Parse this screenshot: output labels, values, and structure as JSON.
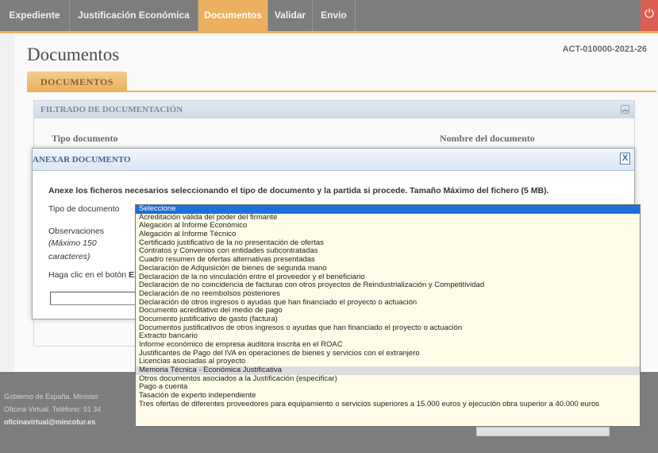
{
  "nav": {
    "items": [
      {
        "label": "Expediente"
      },
      {
        "label": "Justificación Económica"
      },
      {
        "label": "Documentos"
      },
      {
        "label": "Validar"
      },
      {
        "label": "Envio"
      }
    ],
    "active": "Documentos",
    "power_icon": "power-icon",
    "colors": {
      "bar": "#6b6b6b",
      "active": "#e8a54a",
      "power": "#d8483a"
    }
  },
  "page": {
    "title": "Documentos",
    "case_code": "ACT-010000-2021-26",
    "tab": "DOCUMENTOS"
  },
  "filter": {
    "header": "FILTRADO DE DOCUMENTACIÓN",
    "collapse_icon": "chevron-double-up-icon",
    "tipo_label": "Tipo documento",
    "nombre_label": "Nombre del documento"
  },
  "modal": {
    "title": "ANEXAR DOCUMENTO",
    "close": "X",
    "instructions": "Anexe los ficheros necesarios seleccionando el tipo de documento y la partida si procede. Tamaño Máximo del fichero (5 MB).",
    "tipo_label": "Tipo de documento",
    "obs_label": "Observaciones",
    "obs_hint1": "(Máximo 150",
    "obs_hint2": "caracteres)",
    "click_prefix": "Haga clic en el botón",
    "click_bold": "EX"
  },
  "dropdown": {
    "selected": "Seleccione",
    "hovered": "Memoria Técnica - Económica Justificativa",
    "options": [
      "Seleccione",
      "Acreditación válida del poder del firmante",
      "Alegación al Informe Económico",
      "Alegación al Informe Técnico",
      "Certificado justificativo de la no presentación de ofertas",
      "Contratos y Convenios con entidades subcontratadas",
      "Cuadro resumen de ofertas alternativas presentadas",
      "Declaración de Adquisición de bienes de segunda mano",
      "Declaración de la no vinculación entre el proveedor y el beneficiario",
      "Declaración de no coincidencia de facturas con otros proyectos de Reindustrialización y Competitividad",
      "Declaración de no reembolsos posteriores",
      "Declaración de otros ingresos o ayudas que han financiado el proyecto o actuación",
      "Documento acreditativo del medio de pago",
      "Documento justificativo de gasto (factura)",
      "Documentos justificativos de otros ingresos o ayudas que han financiado el proyecto o actuación",
      "Extracto bancario",
      "Informe económico de empresa auditora inscrita en el ROAC",
      "Justificantes de Pago del IVA en operaciones de bienes y servicios con el extranjero",
      "Licencias asociadas al proyecto",
      "Memoria Técnica - Económica Justificativa",
      "Otros documentos asociados a la Justificación (especificar)",
      "Pago a cuenta",
      "Tasación de experto independiente",
      "Tres ofertas de diferentes proveedores para equipamiento o servicios superiores a 15.000 euros y ejecución obra superior a 40.000 euros"
    ]
  },
  "footer": {
    "line1": "Gobierno de España. Minister",
    "line2": "Oficina Virtual. Teléfono: 91 34",
    "email": "oficinavirtual@mincotur.es"
  }
}
